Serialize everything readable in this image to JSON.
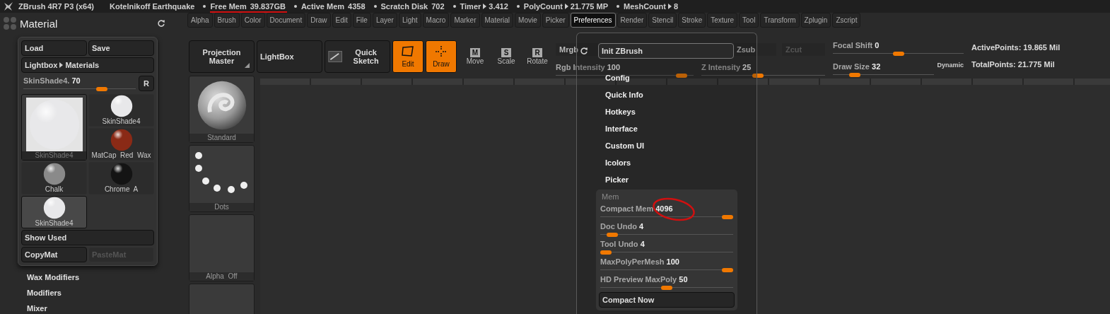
{
  "title_bar": {
    "app": "ZBrush 4R7 P3 (x64)",
    "project": "Kotelnikoff Earthquake",
    "stats": [
      {
        "label": "Free Mem",
        "value": "39.837GB",
        "arrow": false,
        "annotated": true
      },
      {
        "label": "Active Mem",
        "value": "4358",
        "arrow": false,
        "annotated": false
      },
      {
        "label": "Scratch Disk",
        "value": "702",
        "arrow": false,
        "annotated": false
      },
      {
        "label": "Timer",
        "value": "3.412",
        "arrow": true,
        "annotated": false
      },
      {
        "label": "PolyCount",
        "value": "21.775 MP",
        "arrow": true,
        "annotated": false
      },
      {
        "label": "MeshCount",
        "value": "8",
        "arrow": true,
        "annotated": false
      }
    ]
  },
  "material": {
    "title": "Material",
    "load": "Load",
    "save": "Save",
    "lightbox": {
      "label": "Lightbox",
      "target": "Materials"
    },
    "slider": {
      "label": "SkinShade4.",
      "value": "70",
      "level": 0.72
    },
    "reset": "R",
    "current": {
      "label": "SkinShade4",
      "color": "#e8e8ea"
    },
    "materials": [
      {
        "label": "SkinShade4",
        "color": "#e8e8ea",
        "selected": false
      },
      {
        "label": "MatCap  Red  Wax",
        "color": "#8a2a16",
        "selected": false
      },
      {
        "label": "Chalk",
        "color": "#8a8a8a",
        "selected": false
      },
      {
        "label": "Chrome  A",
        "color": "#141414",
        "selected": false
      },
      {
        "label": "SkinShade4",
        "color": "#e8e8ea",
        "selected": true
      }
    ],
    "show_used": "Show Used",
    "copy": {
      "label": "CopyMat",
      "disabled": false
    },
    "paste": {
      "label": "PasteMat",
      "disabled": true
    },
    "sections": [
      "Wax Modifiers",
      "Modifiers",
      "Mixer"
    ]
  },
  "menu": [
    {
      "label": "Alpha",
      "selected": false
    },
    {
      "label": "Brush",
      "selected": false
    },
    {
      "label": "Color",
      "selected": false
    },
    {
      "label": "Document",
      "selected": false
    },
    {
      "label": "Draw",
      "selected": false
    },
    {
      "label": "Edit",
      "selected": false
    },
    {
      "label": "File",
      "selected": false
    },
    {
      "label": "Layer",
      "selected": false
    },
    {
      "label": "Light",
      "selected": false
    },
    {
      "label": "Macro",
      "selected": false
    },
    {
      "label": "Marker",
      "selected": false
    },
    {
      "label": "Material",
      "selected": false
    },
    {
      "label": "Movie",
      "selected": false
    },
    {
      "label": "Picker",
      "selected": false
    },
    {
      "label": "Preferences",
      "selected": true
    },
    {
      "label": "Render",
      "selected": false
    },
    {
      "label": "Stencil",
      "selected": false
    },
    {
      "label": "Stroke",
      "selected": false
    },
    {
      "label": "Texture",
      "selected": false
    },
    {
      "label": "Tool",
      "selected": false
    },
    {
      "label": "Transform",
      "selected": false
    },
    {
      "label": "Zplugin",
      "selected": false
    },
    {
      "label": "Zscript",
      "selected": false
    }
  ],
  "toolbar": {
    "big_buttons": [
      {
        "label": "Projection Master",
        "kind": "dropdown"
      },
      {
        "label": "LightBox",
        "kind": "plain"
      },
      {
        "label": "Quick Sketch",
        "kind": "sketch"
      }
    ],
    "modes": [
      {
        "label": "Edit",
        "kind": "edit",
        "on": true
      },
      {
        "label": "Draw",
        "kind": "draw",
        "on": true
      }
    ],
    "transforms": [
      {
        "key": "M",
        "label": "Move",
        "on": false
      },
      {
        "key": "S",
        "label": "Scale",
        "on": false
      },
      {
        "key": "R",
        "label": "Rotate",
        "on": false
      }
    ],
    "mrgb": {
      "label": "Mrgb",
      "disabled": false
    },
    "rgb_intensity": {
      "label": "Rgb Intensity",
      "value": "100",
      "level": 0.95
    },
    "zsub": {
      "label": "Zsub",
      "disabled": false
    },
    "zcut": {
      "label": "Zcut",
      "disabled": true
    },
    "z_intensity": {
      "label": "Z Intensity",
      "value": "25",
      "level": 0.45
    },
    "focal_shift": {
      "label": "Focal Shift",
      "value": "0",
      "level": 0.5
    },
    "draw_size": {
      "label": "Draw Size",
      "value": "32",
      "level": 0.18
    },
    "dynamic": "Dynamic",
    "active_points": "ActivePoints: 19.865 Mil",
    "total_points": "TotalPoints: 21.775 Mil"
  },
  "tool_slots": [
    {
      "label": "Standard",
      "kind": "brush"
    },
    {
      "label": "Dots",
      "kind": "stroke"
    },
    {
      "label": "Alpha  Off",
      "kind": "alpha"
    },
    {
      "kind": "empty"
    }
  ],
  "preferences_menu": {
    "init": "Init ZBrush",
    "items": [
      "Config",
      "Quick Info",
      "Hotkeys",
      "Interface",
      "Custom UI",
      "Icolors",
      "Picker"
    ],
    "mem": {
      "title": "Mem",
      "sliders": [
        {
          "label": "Compact Mem",
          "value": "4096",
          "level": 1,
          "annotated": true
        },
        {
          "label": "Doc Undo",
          "value": "4",
          "level": 0.05,
          "annotated": false
        },
        {
          "label": "Tool Undo",
          "value": "4",
          "level": 0,
          "annotated": false
        },
        {
          "label": "MaxPolyPerMesh",
          "value": "100",
          "level": 1,
          "annotated": false
        },
        {
          "label": "HD Preview MaxPoly",
          "value": "50",
          "level": 0.5,
          "annotated": false
        }
      ],
      "action": "Compact Now"
    }
  }
}
